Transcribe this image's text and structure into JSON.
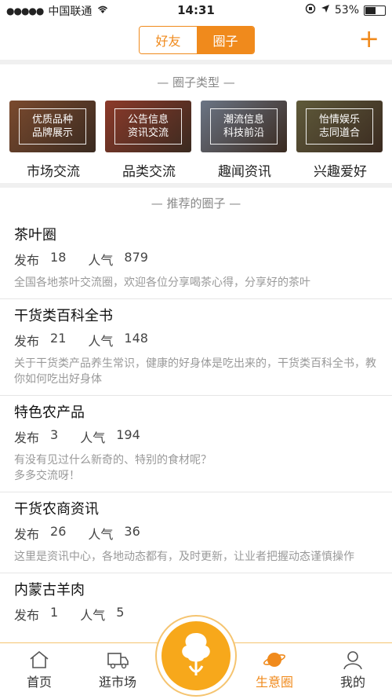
{
  "status": {
    "carrier": "中国联通",
    "time": "14:31",
    "battery": "53%",
    "battery_level": 0.53
  },
  "nav": {
    "tab_friends": "好友",
    "tab_circle": "圈子",
    "plus": "+"
  },
  "types_section": {
    "title": "— 圈子类型 —"
  },
  "categories": [
    {
      "line1": "优质品种",
      "line2": "品牌展示",
      "name": "市场交流",
      "color": "#7a4a2e"
    },
    {
      "line1": "公告信息",
      "line2": "资讯交流",
      "name": "品类交流",
      "color": "#8c3a2a"
    },
    {
      "line1": "潮流信息",
      "line2": "科技前沿",
      "name": "趣闻资讯",
      "color": "#6b7585"
    },
    {
      "line1": "怡情娱乐",
      "line2": "志同道合",
      "name": "兴趣爱好",
      "color": "#5f5a3a"
    }
  ],
  "recommended_section": {
    "title": "— 推荐的圈子 —"
  },
  "circles": [
    {
      "name": "茶叶圈",
      "posts_label": "发布",
      "posts": "18",
      "pop_label": "人气",
      "pop": "879",
      "desc": "全国各地茶叶交流圈，欢迎各位分享喝茶心得，分享好的茶叶"
    },
    {
      "name": "干货类百科全书",
      "posts_label": "发布",
      "posts": "21",
      "pop_label": "人气",
      "pop": "148",
      "desc": "关于干货类产品养生常识，健康的好身体是吃出来的，干货类百科全书，教你如何吃出好身体"
    },
    {
      "name": "特色农产品",
      "posts_label": "发布",
      "posts": "3",
      "pop_label": "人气",
      "pop": "194",
      "desc": "有没有见过什么新奇的、特别的食材呢？\n多多交流呀！"
    },
    {
      "name": "干货农商资讯",
      "posts_label": "发布",
      "posts": "26",
      "pop_label": "人气",
      "pop": "36",
      "desc": "这里是资讯中心，各地动态都有，及时更新，让业者把握动态谨慎操作"
    },
    {
      "name": "内蒙古羊肉",
      "posts_label": "发布",
      "posts": "1",
      "pop_label": "人气",
      "pop": "5",
      "desc": ""
    }
  ],
  "tabbar": {
    "home": "首页",
    "market": "逛市场",
    "business": "生意圈",
    "mine": "我的"
  },
  "colors": {
    "accent": "#f08a1c",
    "center": "#f7a81b"
  }
}
